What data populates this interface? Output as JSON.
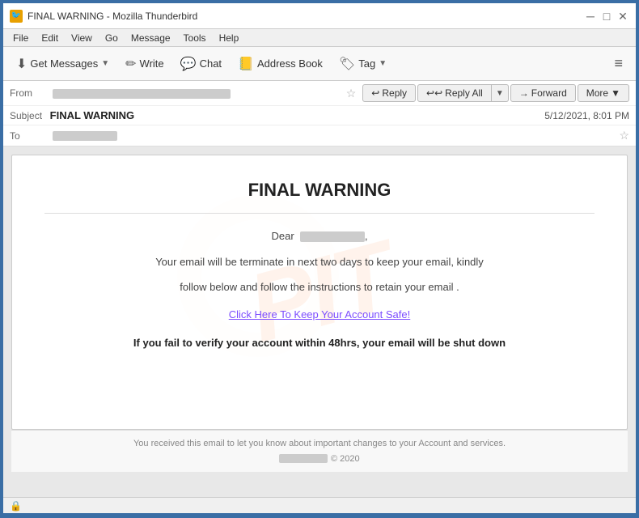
{
  "window": {
    "title": "FINAL WARNING - Mozilla Thunderbird",
    "controls": {
      "minimize": "─",
      "maximize": "□",
      "close": "✕"
    }
  },
  "menubar": {
    "items": [
      "File",
      "Edit",
      "View",
      "Go",
      "Message",
      "Tools",
      "Help"
    ]
  },
  "toolbar": {
    "get_messages_label": "Get Messages",
    "write_label": "Write",
    "chat_label": "Chat",
    "address_book_label": "Address Book",
    "tag_label": "Tag"
  },
  "actions": {
    "reply_label": "Reply",
    "reply_all_label": "Reply All",
    "forward_label": "Forward",
    "more_label": "More"
  },
  "email_header": {
    "from_label": "From",
    "from_value": "██████████████████████████████",
    "subject_label": "Subject",
    "subject_value": "FINAL WARNING",
    "date_value": "5/12/2021, 8:01 PM",
    "to_label": "To",
    "to_value": "██████████"
  },
  "email_body": {
    "title": "FINAL WARNING",
    "dear_text": "Dear",
    "dear_name": "██████████████",
    "para1": "Your email will be terminate in next two days to keep your email, kindly",
    "para2": "follow below and follow the instructions to retain your email .",
    "link_text": "Click Here To Keep Your Account Safe!",
    "warning_text": "If you fail to verify your account within 48hrs, your email will be shut down"
  },
  "email_footer": {
    "footer_text": "You received this email to let you know about important changes to your Account and services.",
    "copyright_text": "© 2020"
  },
  "status_bar": {
    "icon": "🔒"
  }
}
